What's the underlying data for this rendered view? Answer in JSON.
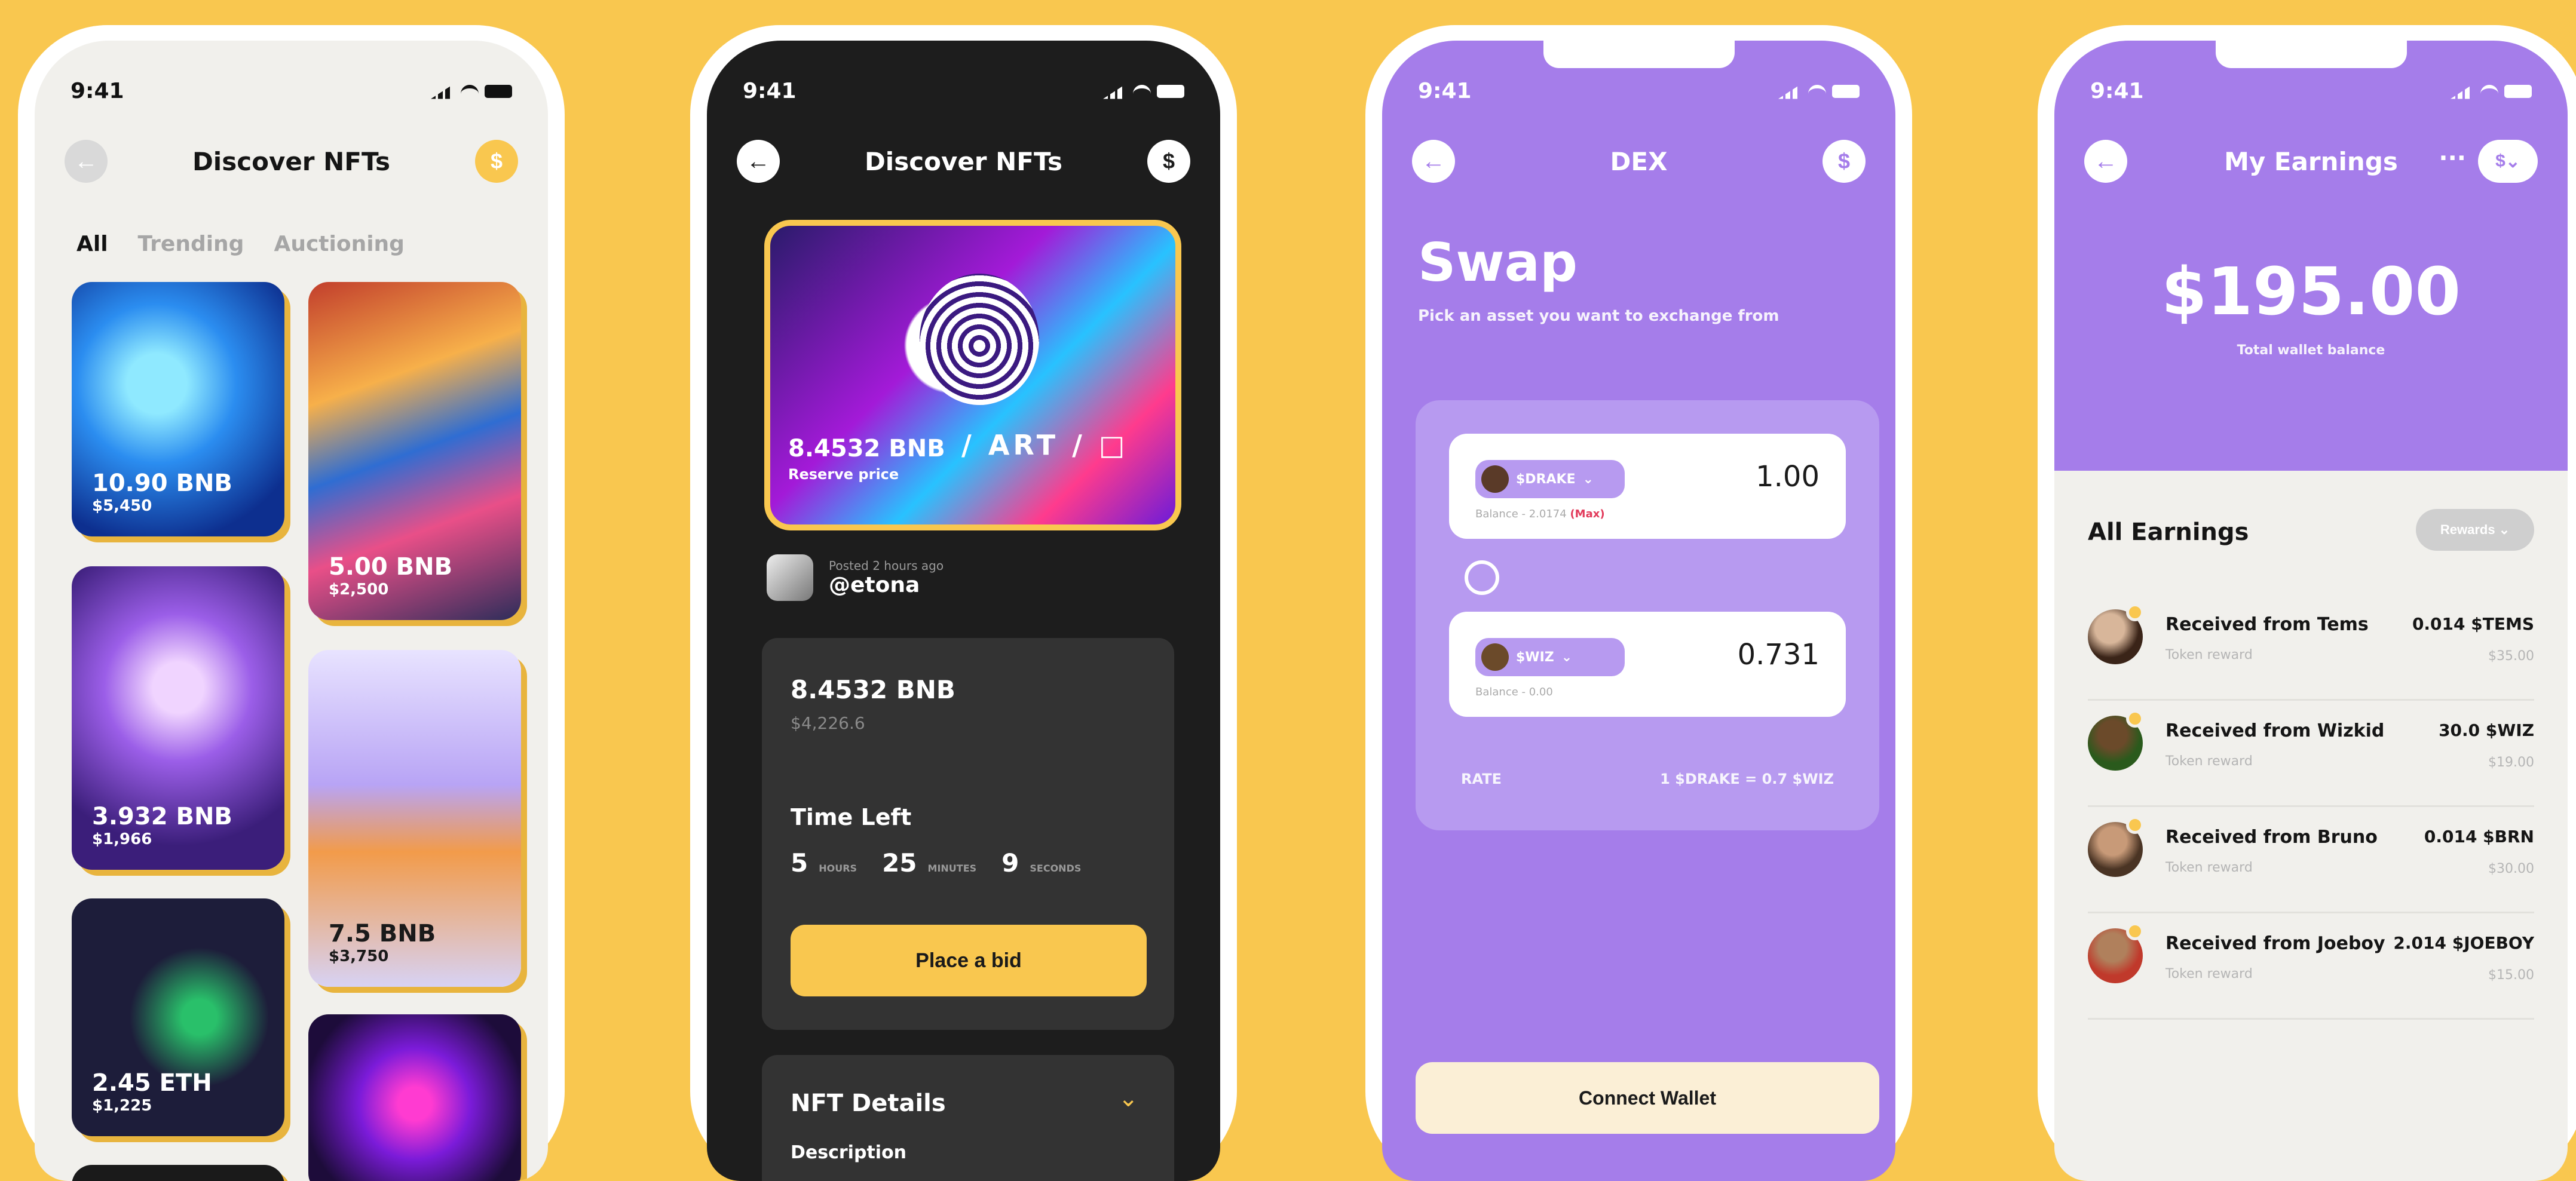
{
  "status_time": "9:41",
  "colors": {
    "background": "#F9C74F",
    "accent_yellow": "#F9C74F",
    "accent_purple": "#A57DEA",
    "dark": "#1D1D1D"
  },
  "phone1": {
    "title": "Discover NFTs",
    "tabs": [
      "All",
      "Trending",
      "Auctioning"
    ],
    "cards": [
      {
        "price": "10.90 BNB",
        "usd": "$5,450"
      },
      {
        "price": "5.00 BNB",
        "usd": "$2,500"
      },
      {
        "price": "3.932 BNB",
        "usd": "$1,966"
      },
      {
        "price": "7.5 BNB",
        "usd": "$3,750"
      },
      {
        "price": "2.45 ETH",
        "usd": "$1,225"
      },
      {
        "price": "",
        "usd": ""
      }
    ]
  },
  "phone2": {
    "title": "Discover NFTs",
    "hero_price": "8.4532 BNB",
    "hero_label": "Reserve price",
    "hero_glitch": "/ ART / □",
    "posted": "Posted 2 hours ago",
    "handle": "@etona",
    "bid_value": "8.4532 BNB",
    "bid_usd": "$4,226.6",
    "time_left_label": "Time Left",
    "timer": {
      "hours": "5",
      "hours_label": "HOURS",
      "minutes": "25",
      "minutes_label": "MINUTES",
      "seconds": "9",
      "seconds_label": "SECONDS"
    },
    "bid_button": "Place a bid",
    "details_title": "NFT Details",
    "description_label": "Description"
  },
  "phone3": {
    "title": "DEX",
    "heading": "Swap",
    "subheading": "Pick an asset you want to exchange from",
    "from": {
      "asset": "$DRAKE",
      "amount": "1.00",
      "balance": "Balance - 2.0174",
      "max": "(Max)"
    },
    "to": {
      "asset": "$WIZ",
      "amount": "0.731",
      "balance": "Balance - 0.00"
    },
    "rate_label": "RATE",
    "rate_value": "1 $DRAKE = 0.7 $WIZ",
    "connect_button": "Connect Wallet"
  },
  "phone4": {
    "title": "My Earnings",
    "coin_label": "$",
    "balance": "$195.00",
    "balance_label": "Total wallet balance",
    "section_title": "All Earnings",
    "filter_label": "Rewards",
    "rows": [
      {
        "who": "Received from Tems",
        "kind": "Token reward",
        "tok": "0.014 $TEMS",
        "usd": "$35.00"
      },
      {
        "who": "Received from Wizkid",
        "kind": "Token reward",
        "tok": "30.0 $WIZ",
        "usd": "$19.00"
      },
      {
        "who": "Received from Bruno",
        "kind": "Token reward",
        "tok": "0.014 $BRN",
        "usd": "$30.00"
      },
      {
        "who": "Received from Joeboy",
        "kind": "Token reward",
        "tok": "2.014 $JOEBOY",
        "usd": "$15.00"
      }
    ]
  }
}
